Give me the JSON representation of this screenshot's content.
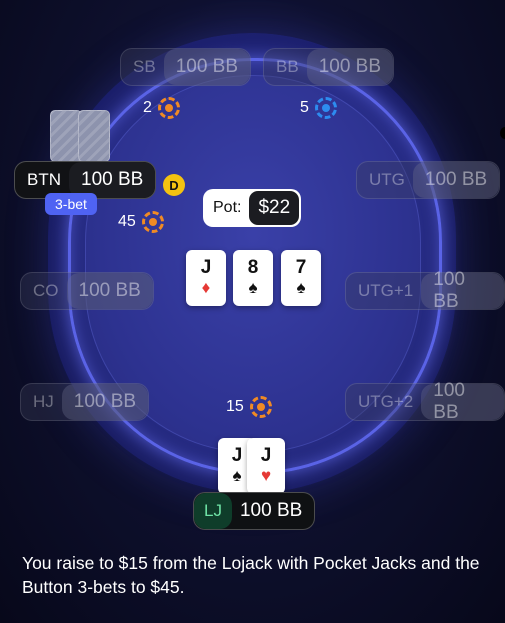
{
  "seats": {
    "sb": {
      "position": "SB",
      "stack": "100 BB"
    },
    "bb": {
      "position": "BB",
      "stack": "100 BB"
    },
    "btn": {
      "position": "BTN",
      "stack": "100 BB",
      "badge": "3-bet"
    },
    "utg": {
      "position": "UTG",
      "stack": "100 BB"
    },
    "co": {
      "position": "CO",
      "stack": "100 BB"
    },
    "utg1": {
      "position": "UTG+1",
      "stack": "100 BB"
    },
    "hj": {
      "position": "HJ",
      "stack": "100 BB"
    },
    "utg2": {
      "position": "UTG+2",
      "stack": "100 BB"
    },
    "lj": {
      "position": "LJ",
      "stack": "100 BB"
    }
  },
  "dealer_button": "D",
  "bets": {
    "sb": "2",
    "bb": "5",
    "btn": "45",
    "lj": "15"
  },
  "pot": {
    "label": "Pot:",
    "amount": "$22"
  },
  "board": [
    {
      "rank": "J",
      "suit": "♦",
      "color": "red"
    },
    {
      "rank": "8",
      "suit": "♠",
      "color": "black"
    },
    {
      "rank": "7",
      "suit": "♠",
      "color": "black"
    }
  ],
  "hero_cards": [
    {
      "rank": "J",
      "suit": "♠",
      "color": "black"
    },
    {
      "rank": "J",
      "suit": "♥",
      "color": "red"
    }
  ],
  "caption": "You raise to $15 from the Lojack with Pocket Jacks and the Button 3-bets to $45.",
  "colors": {
    "chip_orange": "#f08a24",
    "chip_blue": "#2d8cf0",
    "badge": "#4f63f3",
    "dealer": "#f3c211",
    "hero_pos": "#6fe3a6"
  }
}
